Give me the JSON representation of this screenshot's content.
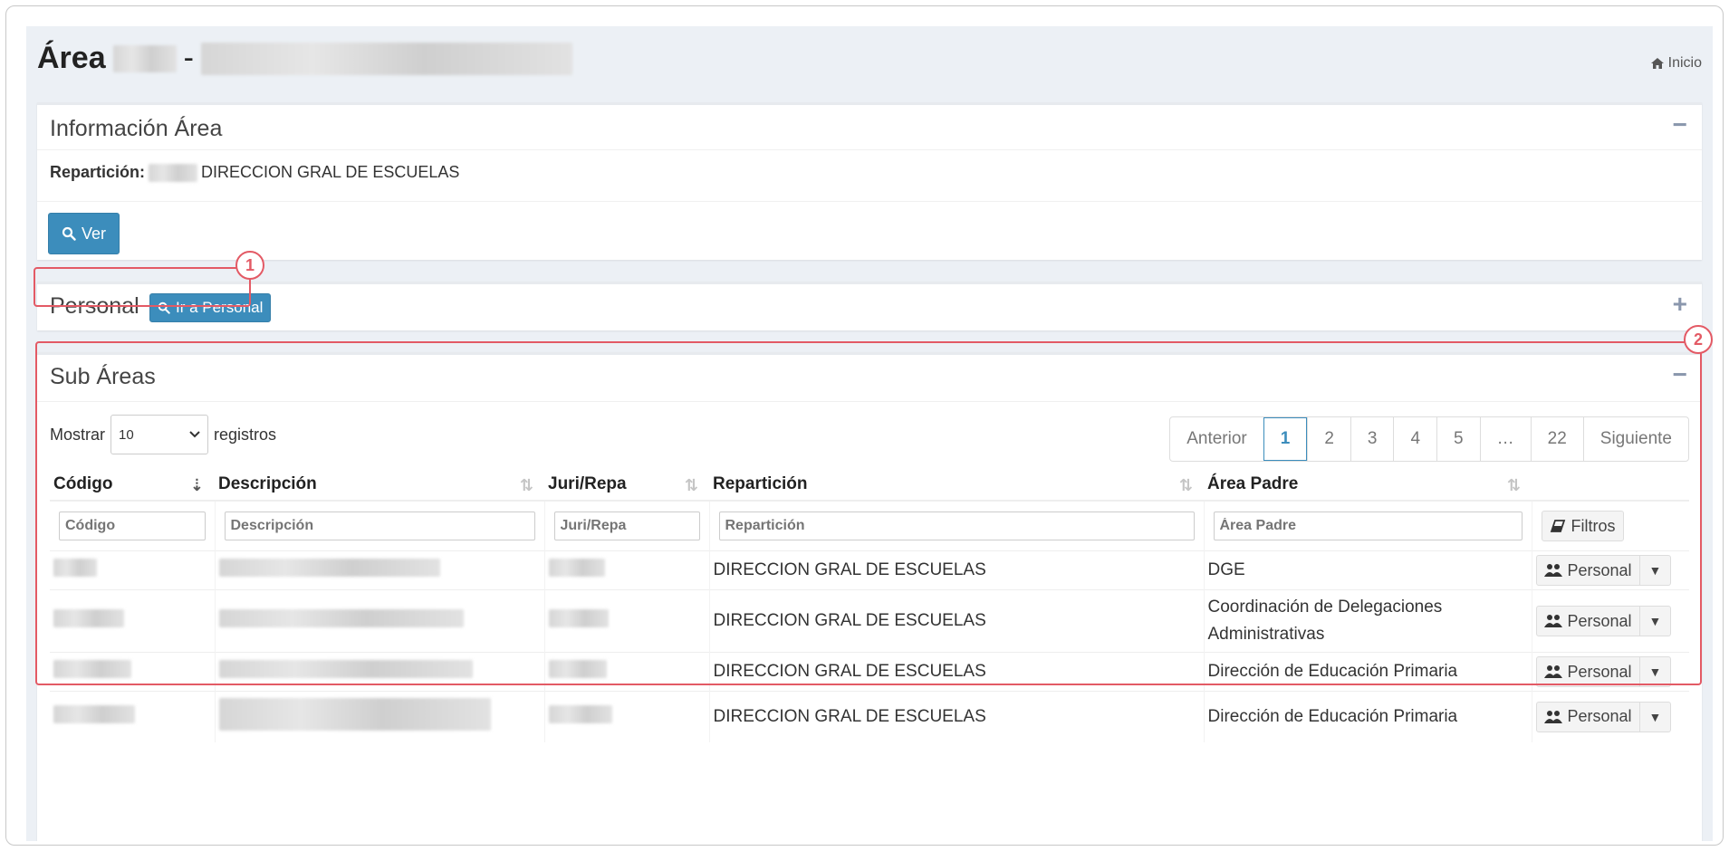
{
  "header": {
    "title": "Área",
    "separator": "-",
    "breadcrumb_home": "Inicio"
  },
  "info_box": {
    "title": "Información Área",
    "collapse_icon": "−",
    "reparticion_label": "Repartición:",
    "reparticion_value": "DIRECCION GRAL DE ESCUELAS",
    "ver_button": "Ver"
  },
  "personal_box": {
    "title": "Personal",
    "button": "Ir a Personal",
    "expand_icon": "+",
    "annotation": "1"
  },
  "subareas_box": {
    "title": "Sub Áreas",
    "collapse_icon": "−",
    "annotation": "2",
    "show_label": "Mostrar",
    "show_value": "10",
    "records_label": "registros",
    "pagination": {
      "prev": "Anterior",
      "pages": [
        "1",
        "2",
        "3",
        "4",
        "5",
        "…",
        "22"
      ],
      "next": "Siguiente",
      "active": "1"
    },
    "columns": [
      "Código",
      "Descripción",
      "Juri/Repa",
      "Repartición",
      "Área Padre"
    ],
    "filters": [
      "Código",
      "Descripción",
      "Juri/Repa",
      "Repartición",
      "Área Padre"
    ],
    "filters_button": "Filtros",
    "row_button": "Personal",
    "rows": [
      {
        "reparticion": "DIRECCION GRAL DE ESCUELAS",
        "area_padre": "DGE"
      },
      {
        "reparticion": "DIRECCION GRAL DE ESCUELAS",
        "area_padre": "Coordinación de Delegaciones Administrativas"
      },
      {
        "reparticion": "DIRECCION GRAL DE ESCUELAS",
        "area_padre": "Dirección de Educación Primaria"
      },
      {
        "reparticion": "DIRECCION GRAL DE ESCUELAS",
        "area_padre": "Dirección de Educación Primaria"
      }
    ]
  },
  "colors": {
    "primary": "#3c8dbc",
    "annotation": "#e35a65",
    "background": "#ecf0f5"
  }
}
